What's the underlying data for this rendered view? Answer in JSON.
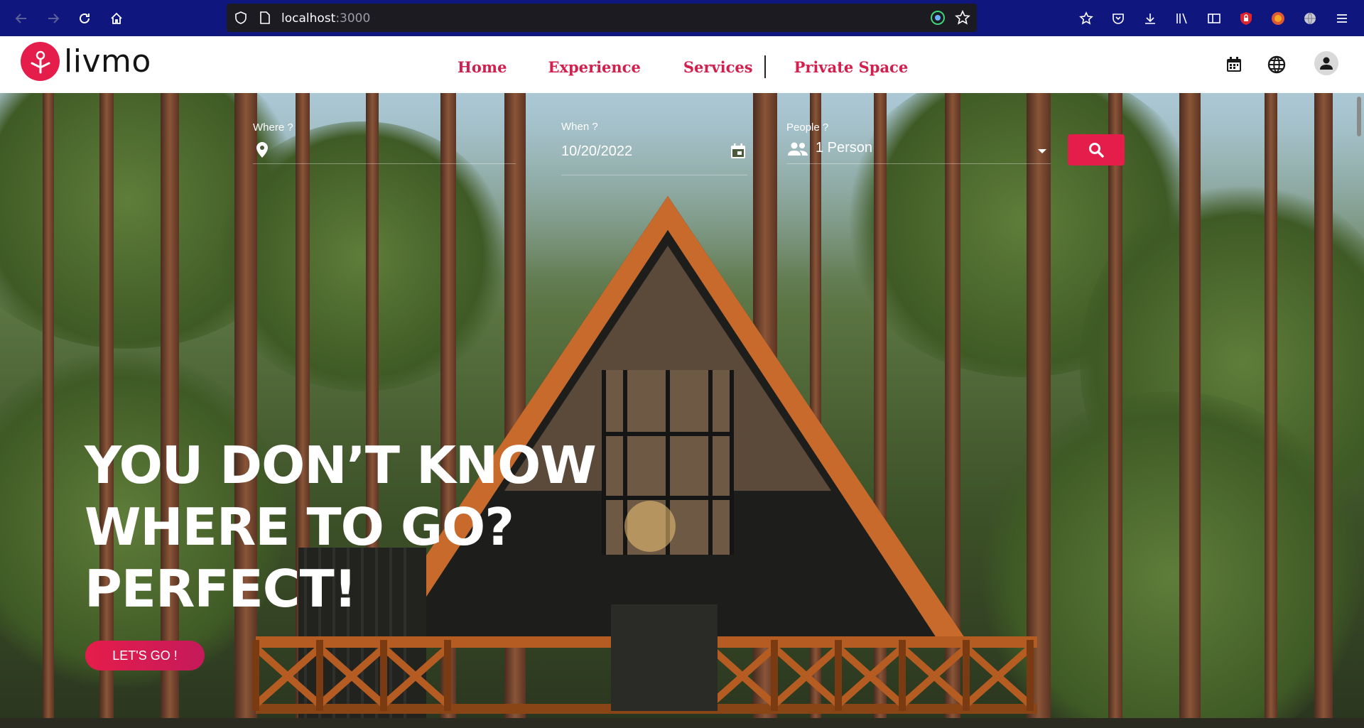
{
  "browser": {
    "url_host": "localhost",
    "url_port": ":3000"
  },
  "app": {
    "logo_text": "livmo",
    "nav": [
      {
        "label": "Home"
      },
      {
        "label": "Experience"
      },
      {
        "label": "Services"
      },
      {
        "label": "Private Space"
      }
    ]
  },
  "search": {
    "where_label": "Where ?",
    "where_value": "",
    "when_label": "When ?",
    "when_value": "10/20/2022",
    "people_label": "People ?",
    "people_value": "1 Person"
  },
  "hero": {
    "headline_lines": [
      "YOU DON’T KNOW",
      "WHERE TO GO?",
      "PERFECT!"
    ],
    "cta_label": "LET'S GO !"
  },
  "colors": {
    "brand": "#e51d4b",
    "browser_chrome": "#0f177f"
  }
}
